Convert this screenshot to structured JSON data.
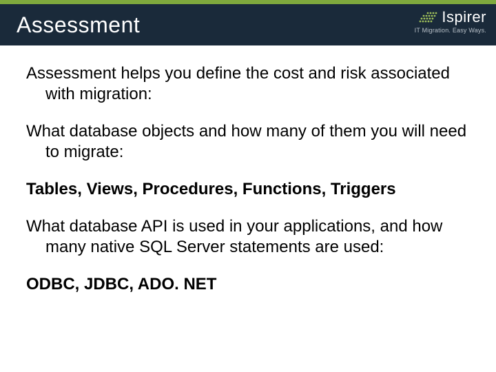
{
  "header": {
    "title": "Assessment",
    "logo": {
      "name": "Ispirer",
      "tagline": "IT Migration. Easy Ways."
    }
  },
  "body": {
    "p1": "Assessment helps you define the cost and risk associated with migration:",
    "p2": "What database objects and how many of them you will need to migrate:",
    "p3": "Tables, Views, Procedures, Functions, Triggers",
    "p4": "What database API is used in your applications, and how many native SQL Server statements are used:",
    "p5": "ODBC, JDBC, ADO. NET"
  }
}
